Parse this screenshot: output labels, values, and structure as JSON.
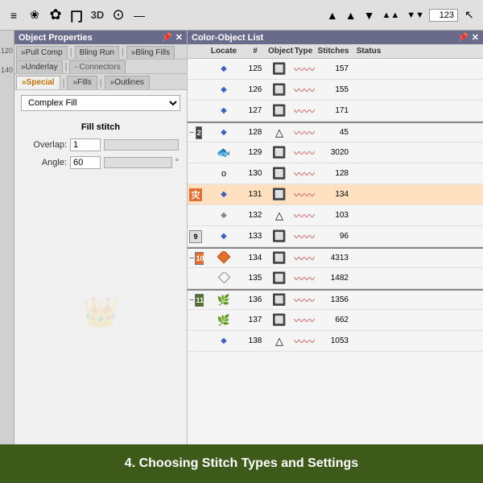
{
  "topToolbar": {
    "icons": [
      "≡",
      "❀",
      "✿",
      "冂",
      "3D",
      "⊙",
      "—"
    ],
    "arrowButtons": [
      "▲",
      "▲",
      "▼",
      "▲▲",
      "▼▼"
    ],
    "numValue": "123",
    "cursorIcon": "↖"
  },
  "objectProperties": {
    "title": "Object Properties",
    "iconPin": "📌",
    "iconClose": "✕",
    "tabs1": [
      {
        "label": "Pull Comp",
        "active": false
      },
      {
        "label": "Bling Run",
        "active": false
      },
      {
        "label": "Bling Fills",
        "active": false
      },
      {
        "label": "Underlay",
        "active": false
      },
      {
        "label": "Connectors",
        "active": false
      },
      {
        "label": "Special",
        "active": true
      },
      {
        "label": "Fills",
        "active": false
      },
      {
        "label": "Outlines",
        "active": false
      }
    ],
    "dropdownValue": "Complex Fill",
    "fillStitch": {
      "title": "Fill stitch",
      "overlapLabel": "Overlap:",
      "overlapValue": "1",
      "angleLabel": "Angle:",
      "angleValue": "60",
      "angleUnit": "°"
    }
  },
  "colorObjectList": {
    "title": "Color-Object List",
    "iconPin": "📌",
    "iconClose": "✕",
    "headers": [
      "",
      "Locate",
      "#",
      "Object",
      "Type",
      "Stitches",
      "Status"
    ],
    "rows": [
      {
        "group": null,
        "minus": null,
        "locate": "◆",
        "num": "125",
        "objectIcon": "🔲",
        "type": "〰〰",
        "stitches": "157",
        "status": ""
      },
      {
        "group": null,
        "minus": null,
        "locate": "◆",
        "num": "126",
        "objectIcon": "🔲",
        "type": "〰〰",
        "stitches": "155",
        "status": ""
      },
      {
        "group": null,
        "minus": null,
        "locate": "◆",
        "num": "127",
        "objectIcon": "🔲",
        "type": "〰〰",
        "stitches": "171",
        "status": ""
      },
      {
        "group": "2",
        "groupColor": "dark",
        "minus": "−",
        "locate": "◆",
        "num": "128",
        "objectIcon": "△",
        "type": "〰〰",
        "stitches": "45",
        "status": ""
      },
      {
        "group": null,
        "minus": null,
        "locate": "🐟",
        "num": "129",
        "objectIcon": "🔲",
        "type": "〰〰",
        "stitches": "3020",
        "status": ""
      },
      {
        "group": null,
        "minus": null,
        "locate": "o",
        "num": "130",
        "objectIcon": "🔲",
        "type": "〰〰",
        "stitches": "128",
        "status": ""
      },
      {
        "group": null,
        "groupColor": "orange",
        "minus": null,
        "locate": "◆",
        "num": "131",
        "objectIcon": "🔲",
        "type": "〰〰",
        "stitches": "134",
        "status": ""
      },
      {
        "group": null,
        "minus": null,
        "locate": "◆",
        "num": "132",
        "objectIcon": "△",
        "type": "〰〰",
        "stitches": "103",
        "status": ""
      },
      {
        "group": "9",
        "groupColor": "light",
        "minus": null,
        "locate": "◆",
        "num": "133",
        "objectIcon": "🔲",
        "type": "〰〰",
        "stitches": "96",
        "status": ""
      },
      {
        "group": "10",
        "groupColor": "orange",
        "minus": "−",
        "locate": "◆",
        "num": "134",
        "objectIcon": "🔲",
        "type": "〰〰",
        "stitches": "4313",
        "status": ""
      },
      {
        "group": null,
        "minus": null,
        "locate": "◇",
        "num": "135",
        "objectIcon": "🔲",
        "type": "〰〰",
        "stitches": "1482",
        "status": ""
      },
      {
        "group": "11",
        "groupColor": "green",
        "minus": "−",
        "locate": "🌿",
        "num": "136",
        "objectIcon": "🔲",
        "type": "〰〰",
        "stitches": "1356",
        "status": ""
      },
      {
        "group": null,
        "minus": null,
        "locate": "🌿",
        "num": "137",
        "objectIcon": "🔲",
        "type": "〰〰",
        "stitches": "662",
        "status": ""
      },
      {
        "group": null,
        "minus": null,
        "locate": "◆",
        "num": "138",
        "objectIcon": "△",
        "type": "〰〰",
        "stitches": "1053",
        "status": ""
      }
    ]
  },
  "footer": {
    "text": "4. Choosing Stitch Types and Settings"
  },
  "rulerMarks": [
    "120",
    "140"
  ]
}
